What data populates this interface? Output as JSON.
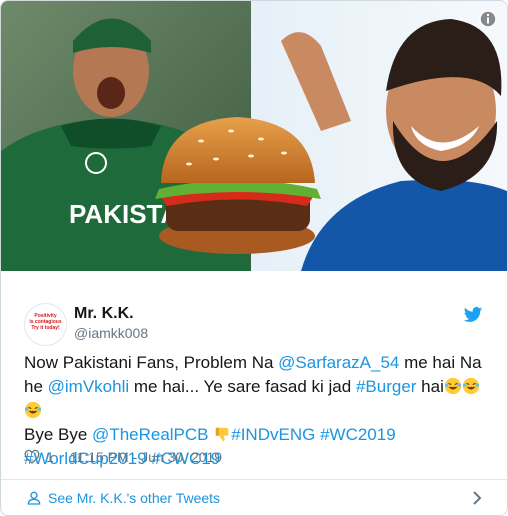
{
  "tweet": {
    "display_name": "Mr. K.K.",
    "handle": "@iamkk008",
    "avatar_text": [
      "Positivity",
      "is contagious",
      "Try it today!"
    ],
    "text_segments": [
      {
        "t": "Now Pakistani Fans, Problem Na ",
        "link": false
      },
      {
        "t": "@SarfarazA_54",
        "link": true
      },
      {
        "t": " me hai Na he ",
        "link": false
      },
      {
        "t": "@imVkohli",
        "link": true
      },
      {
        "t": " me hai... Ye sare fasad ki jad ",
        "link": false
      },
      {
        "t": "#Burger",
        "link": true
      },
      {
        "t": " hai",
        "link": false
      }
    ],
    "line3_segments": [
      {
        "t": "Bye Bye ",
        "link": false
      },
      {
        "t": "@TheRealPCB",
        "link": true
      }
    ],
    "line3_tags": [
      {
        "t": "#INDvENG",
        "link": true
      },
      {
        "t": "#WC2019",
        "link": true
      }
    ],
    "line4_tags": [
      {
        "t": "#WorldCup2019",
        "link": true
      },
      {
        "t": "#CWC19",
        "link": true
      }
    ],
    "likes": "1",
    "timestamp": "11:15 PM - Jun 30, 2019"
  },
  "media": {
    "jersey_text": "PAKISTA"
  },
  "footer": {
    "see_more_label": "See Mr. K.K.'s other Tweets"
  },
  "icons": {
    "info": "info-icon",
    "bird": "twitter-bird-icon",
    "heart": "heart-icon",
    "user": "user-icon",
    "chevron": "chevron-right-icon"
  },
  "colors": {
    "link": "#1b95e0",
    "text": "#14171a",
    "muted": "#657786",
    "twitter_blue": "#1da1f2"
  }
}
